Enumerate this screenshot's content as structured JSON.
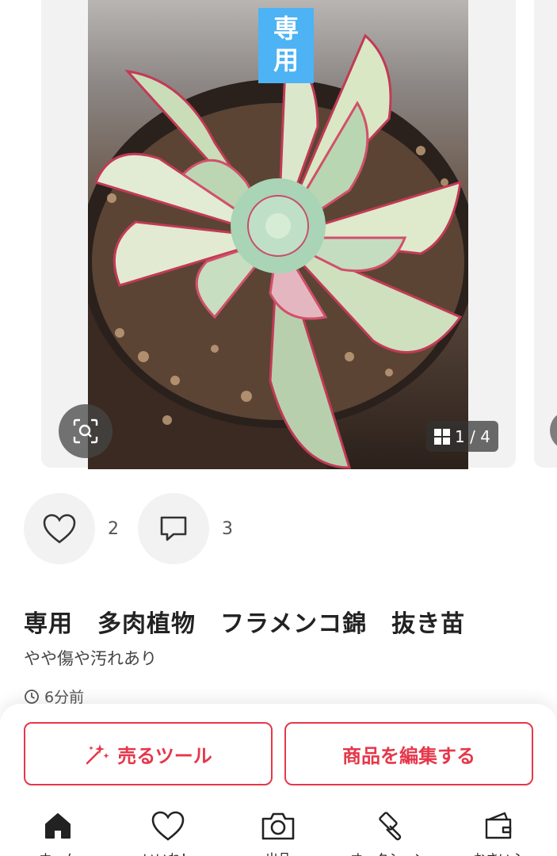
{
  "image": {
    "badge_lines": [
      "専",
      "用"
    ],
    "counter": "1 / 4",
    "icons": {
      "zoom": "lens-scan-icon",
      "gallery": "grid-icon"
    }
  },
  "actions": {
    "likes_count": "2",
    "comments_count": "3",
    "icons": {
      "like": "heart-icon",
      "comment": "comment-icon"
    }
  },
  "item": {
    "title": "専用　多肉植物　フラメンコ錦　抜き苗",
    "condition": "やや傷や汚れあり",
    "posted": "6分前"
  },
  "bottom_buttons": {
    "sell_tool": "売るツール",
    "edit_item": "商品を編集する"
  },
  "nav": {
    "items": [
      {
        "label": "ホーム",
        "icon": "home-icon"
      },
      {
        "label": "いいね！",
        "icon": "heart-icon"
      },
      {
        "label": "出品",
        "icon": "camera-icon"
      },
      {
        "label": "オークション",
        "icon": "gavel-icon"
      },
      {
        "label": "おさいふ",
        "icon": "wallet-icon"
      }
    ]
  },
  "colors": {
    "accent": "#e6374a",
    "badge": "#4db3f4"
  }
}
